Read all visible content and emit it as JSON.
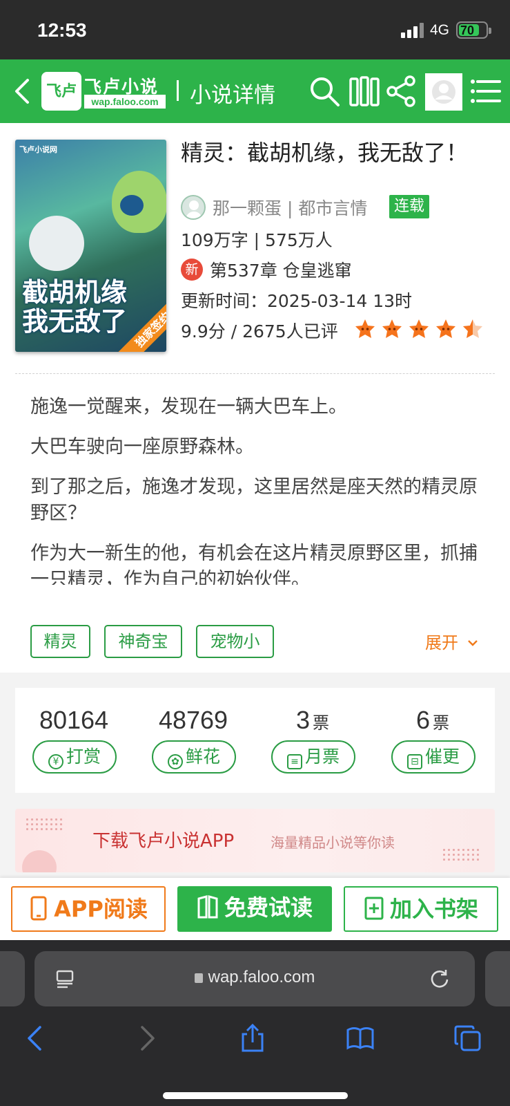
{
  "status": {
    "time": "12:53",
    "network": "4G",
    "battery": "70"
  },
  "header": {
    "logo_name": "飞卢小说",
    "logo_mark": "飞卢",
    "logo_url": "wap.faloo.com",
    "title": "小说详情"
  },
  "book": {
    "title": "精灵：截胡机缘，我无敌了！",
    "author": "那一颗蛋",
    "category": "都市言情",
    "status_badge": "连载",
    "words_readers": "109万字 | 575万人",
    "new_badge": "新",
    "latest_chapter": "第537章 仓皇逃窜",
    "update_time": "更新时间：2025-03-14 13时",
    "rating": "9.9分 / 2675人已评",
    "stars": 4.5,
    "cover": {
      "logo": "飞卢小说网",
      "title": "截胡机缘\n我无敌了",
      "ribbon": "独家签约"
    }
  },
  "description": {
    "paragraphs": [
      "施逸一觉醒来，发现在一辆大巴车上。",
      "大巴车驶向一座原野森林。",
      "到了那之后，施逸才发现，这里居然是座天然的精灵原野区？",
      "作为大一新生的他，有机会在这片精灵原野区里，抓捕一只精灵，作为自己的初始伙伴。"
    ],
    "expand_label": "展开"
  },
  "tags": [
    "精灵",
    "神奇宝",
    "宠物小"
  ],
  "stats": [
    {
      "value": "80164",
      "unit": "",
      "label": "打赏",
      "icon": "yen-icon"
    },
    {
      "value": "48769",
      "unit": "",
      "label": "鲜花",
      "icon": "flower-icon"
    },
    {
      "value": "3",
      "unit": "票",
      "label": "月票",
      "icon": "ticket-icon"
    },
    {
      "value": "6",
      "unit": "票",
      "label": "催更",
      "icon": "urge-icon"
    }
  ],
  "banner": {
    "main": "下载飞卢小说APP",
    "sub": "海量精品小说等你读"
  },
  "actions": {
    "app_read": "APP阅读",
    "free_read": "免费试读",
    "add_shelf": "加入书架"
  },
  "browser": {
    "url": "wap.faloo.com"
  },
  "colors": {
    "brand_green": "#2db34a",
    "accent_orange": "#f07a1a",
    "star_orange": "#f5731c"
  }
}
